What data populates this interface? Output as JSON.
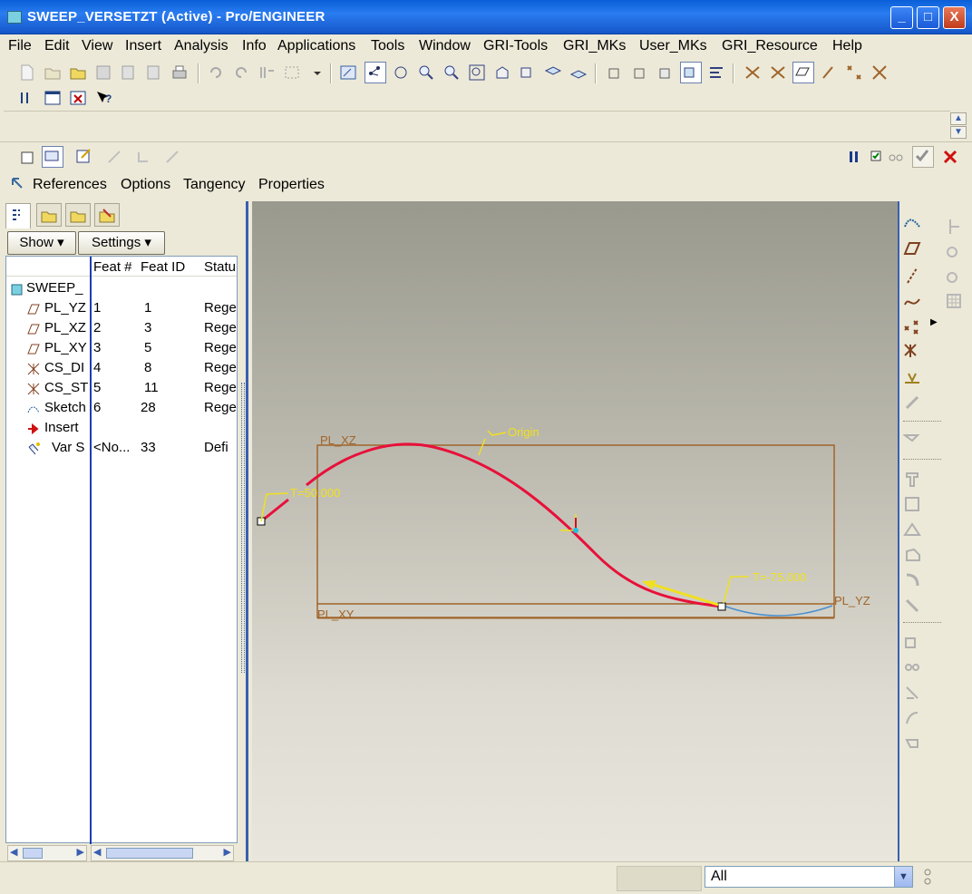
{
  "window": {
    "title": "SWEEP_VERSETZT (Active) - Pro/ENGINEER",
    "minimize": "_",
    "maximize": "□",
    "close": "X"
  },
  "menu": [
    "File",
    "Edit",
    "View",
    "Insert",
    "Analysis",
    "Info",
    "Applications",
    "Tools",
    "Window",
    "GRI-Tools",
    "GRI_MKs",
    "User_MKs",
    "GRI_Resource",
    "Help"
  ],
  "dashboard_tabs": [
    "References",
    "Options",
    "Tangency",
    "Properties"
  ],
  "panel": {
    "show_label": "Show",
    "settings_label": "Settings",
    "columns": [
      "Feat #",
      "Feat ID",
      "Statu"
    ],
    "root": "SWEEP_",
    "rows": [
      {
        "name": "PL_YZ",
        "feat_no": "1",
        "feat_id": "1",
        "status": "Rege",
        "icon": "datum-plane-icon"
      },
      {
        "name": "PL_XZ",
        "feat_no": "2",
        "feat_id": "3",
        "status": "Rege",
        "icon": "datum-plane-icon"
      },
      {
        "name": "PL_XY",
        "feat_no": "3",
        "feat_id": "5",
        "status": "Rege",
        "icon": "datum-plane-icon"
      },
      {
        "name": "CS_DI",
        "feat_no": "4",
        "feat_id": "8",
        "status": "Rege",
        "icon": "coordinate-system-icon"
      },
      {
        "name": "CS_ST",
        "feat_no": "5",
        "feat_id": "11",
        "status": "Rege",
        "icon": "coordinate-system-icon"
      },
      {
        "name": "Sketch",
        "feat_no": "6",
        "feat_id": "28",
        "status": "Rege",
        "icon": "sketch-icon"
      },
      {
        "name": "Insert",
        "feat_no": "",
        "feat_id": "",
        "status": "",
        "icon": "insert-here-arrow-icon"
      },
      {
        "name": "Var S",
        "feat_no": "<No...",
        "feat_id": "33",
        "status": "Defi",
        "icon": "variable-sweep-icon"
      }
    ]
  },
  "graphics": {
    "labels": {
      "origin": "Origin",
      "t_start": "T=50.000",
      "t_end": "T=-75.000",
      "pl_xz": "PL_XZ",
      "pl_xy": "PL_XY",
      "pl_yz": "PL_YZ"
    },
    "colors": {
      "trajectory": "#e8103a",
      "annotation": "#f0e020",
      "datum": "#a0642a",
      "background_top": "#9a998e",
      "background_bottom": "#e8e6dd"
    }
  },
  "status": {
    "filter_value": "All"
  }
}
